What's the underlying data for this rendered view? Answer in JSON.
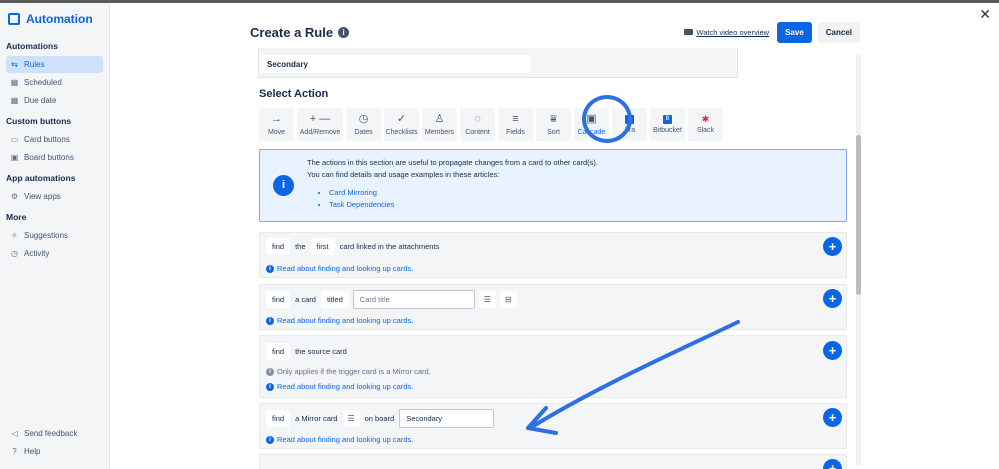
{
  "sidebar": {
    "app_title": "Automation",
    "sections": [
      {
        "label": "Automations",
        "items": [
          {
            "label": "Rules",
            "icon": "sliders-icon",
            "active": true
          },
          {
            "label": "Scheduled",
            "icon": "calendar-icon"
          },
          {
            "label": "Due date",
            "icon": "calendar-icon"
          }
        ]
      },
      {
        "label": "Custom buttons",
        "items": [
          {
            "label": "Card buttons",
            "icon": "card-icon"
          },
          {
            "label": "Board buttons",
            "icon": "board-icon"
          }
        ]
      },
      {
        "label": "App automations",
        "items": [
          {
            "label": "View apps",
            "icon": "gear-icon"
          }
        ]
      },
      {
        "label": "More",
        "items": [
          {
            "label": "Suggestions",
            "icon": "sparkle-icon"
          },
          {
            "label": "Activity",
            "icon": "clock-icon"
          }
        ]
      }
    ],
    "footer": [
      {
        "label": "Send feedback",
        "icon": "megaphone-icon"
      },
      {
        "label": "Help",
        "icon": "help-icon"
      }
    ]
  },
  "header": {
    "title": "Create a Rule",
    "watch_video": "Watch video overview",
    "save_label": "Save",
    "cancel_label": "Cancel"
  },
  "secondary_value": "Secondary",
  "select_action_title": "Select Action",
  "action_tiles": [
    {
      "label": "Move",
      "icon": "→"
    },
    {
      "label": "Add/Remove",
      "icon": "+ —"
    },
    {
      "label": "Dates",
      "icon": "◷"
    },
    {
      "label": "Checklists",
      "icon": "✓"
    },
    {
      "label": "Members",
      "icon": "♙"
    },
    {
      "label": "Content",
      "icon": "◌"
    },
    {
      "label": "Fields",
      "icon": "≡"
    },
    {
      "label": "Sort",
      "icon": "⩸"
    },
    {
      "label": "Cascade",
      "icon": "▣",
      "selected": true
    },
    {
      "label": "Jira",
      "icon": "J",
      "app": true
    },
    {
      "label": "Bitbucket",
      "icon": "B",
      "app": true
    },
    {
      "label": "Slack",
      "icon": "✱",
      "app": true
    }
  ],
  "info_panel": {
    "line1": "The actions in this section are useful to propagate changes from a card to other card(s).",
    "line2": "You can find details and usage examples in these articles:",
    "links": [
      "Card Mirroring",
      "Task Dependencies"
    ]
  },
  "cards": {
    "help_link": "Read about finding and looking up cards.",
    "card1": {
      "find": "find",
      "the": "the",
      "first": "first",
      "rest": "card linked in the attachments"
    },
    "card2": {
      "find": "find",
      "a_card": "a card",
      "titled": "titled",
      "placeholder": "Card title"
    },
    "card3": {
      "find": "find",
      "rest": "the source card",
      "note": "Only applies if the trigger card is a Mirror card."
    },
    "card4": {
      "find": "find",
      "mirror": "a Mirror card",
      "on_board": "on board",
      "board_value": "Secondary"
    }
  },
  "colors": {
    "accent": "#0c66e4",
    "annotation": "#2f6fe4"
  }
}
